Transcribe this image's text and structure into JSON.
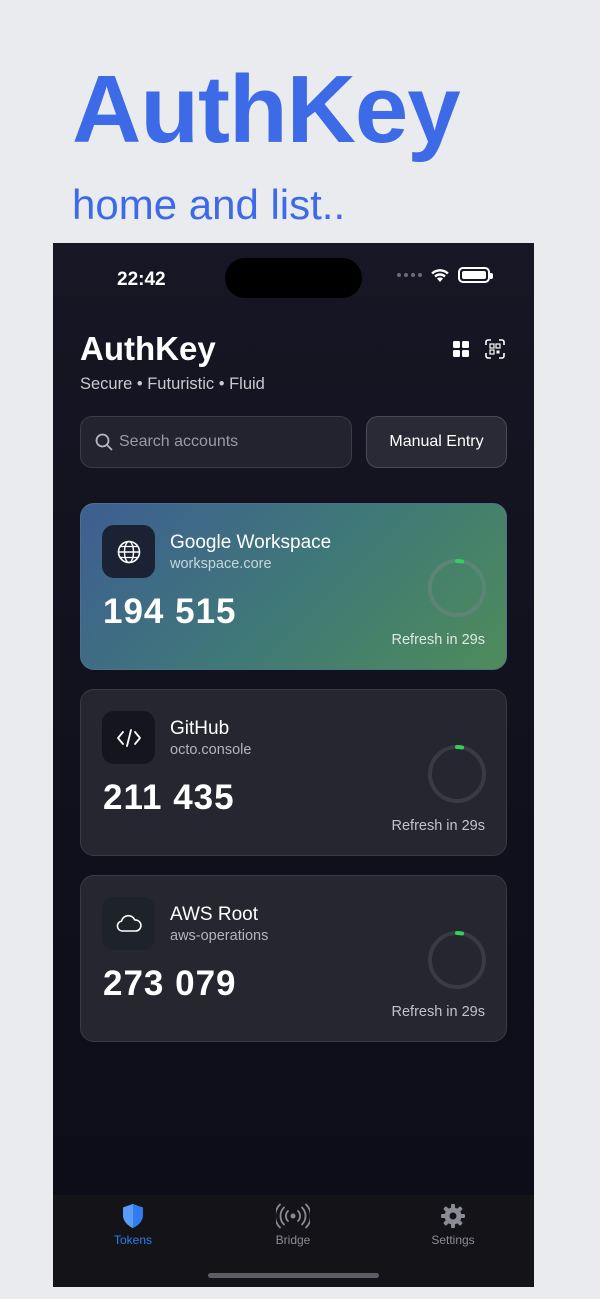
{
  "promo": {
    "title": "AuthKey",
    "subtitle": "home and list.."
  },
  "status_bar": {
    "time": "22:42"
  },
  "header": {
    "title": "AuthKey",
    "tagline": "Secure • Futuristic • Fluid"
  },
  "search": {
    "placeholder": "Search accounts",
    "value": ""
  },
  "manual_entry_label": "Manual Entry",
  "accounts": [
    {
      "name": "Google Workspace",
      "issuer": "workspace.core",
      "code": "194 515",
      "refresh": "Refresh in 29s",
      "icon": "globe-icon",
      "progress": 0.03
    },
    {
      "name": "GitHub",
      "issuer": "octo.console",
      "code": "211 435",
      "refresh": "Refresh in 29s",
      "icon": "code-icon",
      "progress": 0.03
    },
    {
      "name": "AWS Root",
      "issuer": "aws-operations",
      "code": "273 079",
      "refresh": "Refresh in 29s",
      "icon": "cloud-icon",
      "progress": 0.03
    }
  ],
  "tabs": [
    {
      "label": "Tokens",
      "icon": "shield-icon",
      "active": true
    },
    {
      "label": "Bridge",
      "icon": "broadcast-icon",
      "active": false
    },
    {
      "label": "Settings",
      "icon": "gear-icon",
      "active": false
    }
  ],
  "colors": {
    "accent": "#3d6ae6",
    "tab_active": "#2f7bf0",
    "ring_progress": "#2fd158",
    "ring_track": "#3a3a44"
  }
}
